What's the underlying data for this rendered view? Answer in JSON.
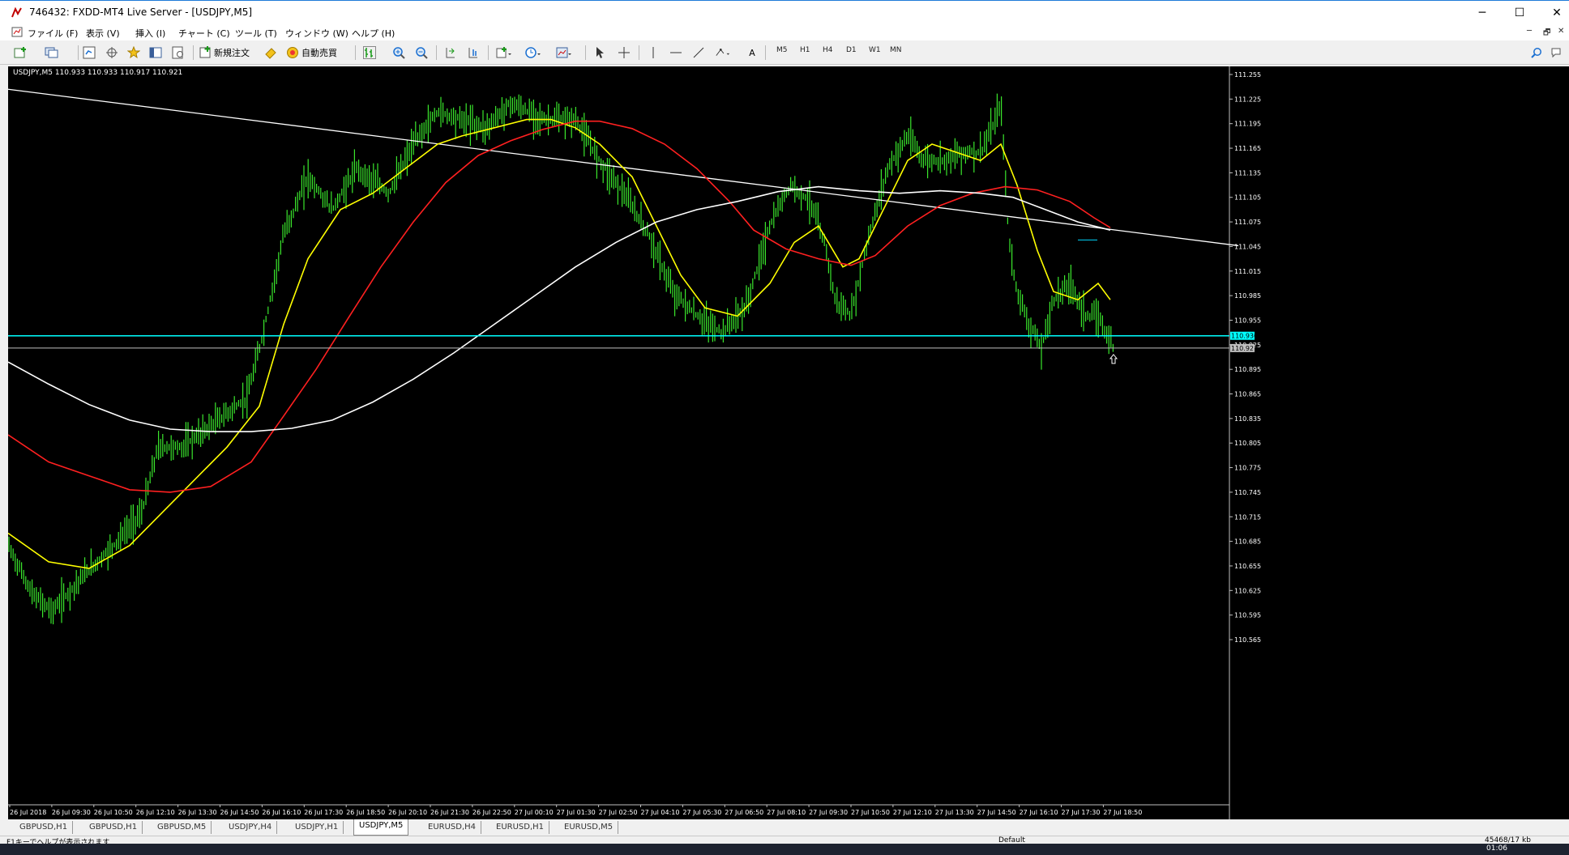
{
  "window": {
    "title": "746432: FXDD-MT4 Live Server - [USDJPY,M5]",
    "minimize": "─",
    "maximize": "☐",
    "close": "✕"
  },
  "menu": [
    "ファイル (F)",
    "表示 (V)",
    "挿入 (I)",
    "チャート (C)",
    "ツール (T)",
    "ウィンドウ (W)",
    "ヘルプ (H)"
  ],
  "mdi_controls": [
    "─",
    "🗗",
    "✕"
  ],
  "toolbar": {
    "new_order": "新規注文",
    "auto_trading": "自動売買",
    "text_tool": "A",
    "timeframes": [
      "M5",
      "H1",
      "H4",
      "D1",
      "W1",
      "MN"
    ]
  },
  "chart_info": "USDJPY,M5  110.933 110.933 110.917 110.921",
  "chart_data": {
    "type": "line",
    "symbol": "USDJPY",
    "timeframe": "M5",
    "price_axis": {
      "range": [
        110.565,
        111.255
      ],
      "ticks": [
        "111.255",
        "111.225",
        "111.195",
        "111.165",
        "111.135",
        "111.105",
        "111.075",
        "111.045",
        "111.015",
        "110.985",
        "110.955",
        "110.925",
        "110.895",
        "110.865",
        "110.835",
        "110.805",
        "110.775",
        "110.745",
        "110.715",
        "110.685",
        "110.655",
        "110.625",
        "110.595",
        "110.565"
      ]
    },
    "time_axis": [
      "26 Jul 2018",
      "26 Jul 09:30",
      "26 Jul 10:50",
      "26 Jul 12:10",
      "26 Jul 13:30",
      "26 Jul 14:50",
      "26 Jul 16:10",
      "26 Jul 17:30",
      "26 Jul 18:50",
      "26 Jul 20:10",
      "26 Jul 21:30",
      "26 Jul 22:50",
      "27 Jul 00:10",
      "27 Jul 01:30",
      "27 Jul 02:50",
      "27 Jul 04:10",
      "27 Jul 05:30",
      "27 Jul 06:50",
      "27 Jul 08:10",
      "27 Jul 09:30",
      "27 Jul 10:50",
      "27 Jul 12:10",
      "27 Jul 13:30",
      "27 Jul 14:50",
      "27 Jul 16:10",
      "27 Jul 17:30",
      "27 Jul 18:50"
    ],
    "price_path": [
      [
        0,
        110.68
      ],
      [
        30,
        110.62
      ],
      [
        55,
        110.6
      ],
      [
        90,
        110.64
      ],
      [
        130,
        110.68
      ],
      [
        165,
        110.72
      ],
      [
        185,
        110.8
      ],
      [
        215,
        110.8
      ],
      [
        255,
        110.83
      ],
      [
        295,
        110.86
      ],
      [
        315,
        110.94
      ],
      [
        340,
        111.06
      ],
      [
        370,
        111.13
      ],
      [
        400,
        111.09
      ],
      [
        430,
        111.14
      ],
      [
        470,
        111.11
      ],
      [
        500,
        111.17
      ],
      [
        530,
        111.21
      ],
      [
        560,
        111.2
      ],
      [
        590,
        111.19
      ],
      [
        620,
        111.22
      ],
      [
        660,
        111.2
      ],
      [
        700,
        111.2
      ],
      [
        730,
        111.15
      ],
      [
        760,
        111.11
      ],
      [
        790,
        111.06
      ],
      [
        820,
        110.99
      ],
      [
        850,
        110.96
      ],
      [
        880,
        110.94
      ],
      [
        910,
        110.97
      ],
      [
        940,
        111.07
      ],
      [
        965,
        111.12
      ],
      [
        990,
        111.1
      ],
      [
        1010,
        111.04
      ],
      [
        1020,
        110.98
      ],
      [
        1040,
        110.96
      ],
      [
        1060,
        111.05
      ],
      [
        1085,
        111.14
      ],
      [
        1110,
        111.18
      ],
      [
        1130,
        111.15
      ],
      [
        1150,
        111.15
      ],
      [
        1180,
        111.16
      ],
      [
        1200,
        111.16
      ],
      [
        1215,
        111.19
      ],
      [
        1225,
        111.22
      ],
      [
        1235,
        111.05
      ],
      [
        1245,
        110.99
      ],
      [
        1260,
        110.95
      ],
      [
        1275,
        110.92
      ],
      [
        1290,
        110.98
      ],
      [
        1310,
        111.0
      ],
      [
        1330,
        110.96
      ],
      [
        1345,
        110.96
      ],
      [
        1360,
        110.93
      ],
      [
        1364,
        110.921
      ]
    ],
    "series": [
      {
        "name": "",
        "color": "#ffff00",
        "points": [
          [
            0,
            110.695
          ],
          [
            50,
            110.66
          ],
          [
            100,
            110.652
          ],
          [
            150,
            110.68
          ],
          [
            190,
            110.72
          ],
          [
            230,
            110.76
          ],
          [
            270,
            110.8
          ],
          [
            310,
            110.85
          ],
          [
            340,
            110.95
          ],
          [
            370,
            111.03
          ],
          [
            410,
            111.09
          ],
          [
            450,
            111.11
          ],
          [
            490,
            111.14
          ],
          [
            530,
            111.17
          ],
          [
            560,
            111.18
          ],
          [
            600,
            111.19
          ],
          [
            640,
            111.2
          ],
          [
            670,
            111.2
          ],
          [
            700,
            111.19
          ],
          [
            730,
            111.17
          ],
          [
            770,
            111.13
          ],
          [
            800,
            111.07
          ],
          [
            830,
            111.01
          ],
          [
            860,
            110.97
          ],
          [
            900,
            110.96
          ],
          [
            940,
            111.0
          ],
          [
            970,
            111.05
          ],
          [
            1000,
            111.07
          ],
          [
            1030,
            111.02
          ],
          [
            1050,
            111.03
          ],
          [
            1080,
            111.09
          ],
          [
            1110,
            111.15
          ],
          [
            1140,
            111.17
          ],
          [
            1170,
            111.16
          ],
          [
            1200,
            111.15
          ],
          [
            1225,
            111.17
          ],
          [
            1245,
            111.12
          ],
          [
            1270,
            111.04
          ],
          [
            1290,
            110.99
          ],
          [
            1320,
            110.98
          ],
          [
            1345,
            111.0
          ],
          [
            1360,
            110.98
          ]
        ]
      },
      {
        "name": "",
        "color": "#ff2020",
        "points": [
          [
            0,
            110.815
          ],
          [
            50,
            110.782
          ],
          [
            100,
            110.765
          ],
          [
            150,
            110.748
          ],
          [
            200,
            110.745
          ],
          [
            250,
            110.752
          ],
          [
            300,
            110.782
          ],
          [
            340,
            110.838
          ],
          [
            380,
            110.895
          ],
          [
            420,
            110.958
          ],
          [
            460,
            111.02
          ],
          [
            500,
            111.075
          ],
          [
            540,
            111.123
          ],
          [
            580,
            111.156
          ],
          [
            620,
            111.174
          ],
          [
            660,
            111.188
          ],
          [
            700,
            111.198
          ],
          [
            730,
            111.198
          ],
          [
            770,
            111.189
          ],
          [
            810,
            111.17
          ],
          [
            850,
            111.14
          ],
          [
            890,
            111.1
          ],
          [
            920,
            111.065
          ],
          [
            960,
            111.042
          ],
          [
            1000,
            111.03
          ],
          [
            1040,
            111.022
          ],
          [
            1070,
            111.034
          ],
          [
            1110,
            111.07
          ],
          [
            1150,
            111.095
          ],
          [
            1190,
            111.11
          ],
          [
            1230,
            111.118
          ],
          [
            1270,
            111.114
          ],
          [
            1310,
            111.1
          ],
          [
            1340,
            111.08
          ],
          [
            1360,
            111.068
          ]
        ]
      },
      {
        "name": "",
        "color": "#ffffff",
        "points": [
          [
            0,
            110.904
          ],
          [
            50,
            110.877
          ],
          [
            100,
            110.852
          ],
          [
            150,
            110.833
          ],
          [
            200,
            110.822
          ],
          [
            250,
            110.819
          ],
          [
            300,
            110.819
          ],
          [
            350,
            110.823
          ],
          [
            400,
            110.833
          ],
          [
            450,
            110.855
          ],
          [
            500,
            110.883
          ],
          [
            550,
            110.915
          ],
          [
            600,
            110.95
          ],
          [
            650,
            110.985
          ],
          [
            700,
            111.02
          ],
          [
            750,
            111.05
          ],
          [
            800,
            111.075
          ],
          [
            850,
            111.09
          ],
          [
            900,
            111.1
          ],
          [
            950,
            111.112
          ],
          [
            1000,
            111.118
          ],
          [
            1050,
            111.113
          ],
          [
            1100,
            111.11
          ],
          [
            1150,
            111.113
          ],
          [
            1200,
            111.11
          ],
          [
            1240,
            111.105
          ],
          [
            1280,
            111.09
          ],
          [
            1320,
            111.075
          ],
          [
            1360,
            111.065
          ]
        ]
      }
    ],
    "trendline": {
      "color": "#ffffff",
      "from": [
        0,
        111.237
      ],
      "to": [
        1518,
        111.046
      ]
    },
    "horizontal_lines": [
      {
        "color": "#00ffff",
        "price": 110.936,
        "label": "110.936"
      },
      {
        "color": "#c0c0c0",
        "price": 110.921,
        "label": "110.921"
      },
      {
        "color": "#00d8ff",
        "price": 111.053,
        "x_from": 1320,
        "x_to": 1344
      }
    ],
    "current_price": 110.921,
    "grid": false
  },
  "tabs": [
    {
      "label": "GBPUSD,H1",
      "active": false
    },
    {
      "label": "GBPUSD,H1",
      "active": false
    },
    {
      "label": "GBPUSD,M5",
      "active": false
    },
    {
      "label": "USDJPY,H4",
      "active": false
    },
    {
      "label": "USDJPY,H1",
      "active": false
    },
    {
      "label": "USDJPY,M5",
      "active": true
    },
    {
      "label": "EURUSD,H4",
      "active": false
    },
    {
      "label": "EURUSD,H1",
      "active": false
    },
    {
      "label": "EURUSD,M5",
      "active": false
    }
  ],
  "status": {
    "help": "F1キーでヘルプが表示されます",
    "profile": "Default",
    "traffic": "45468/17 kb"
  },
  "taskbar": {
    "time": "01:06"
  }
}
